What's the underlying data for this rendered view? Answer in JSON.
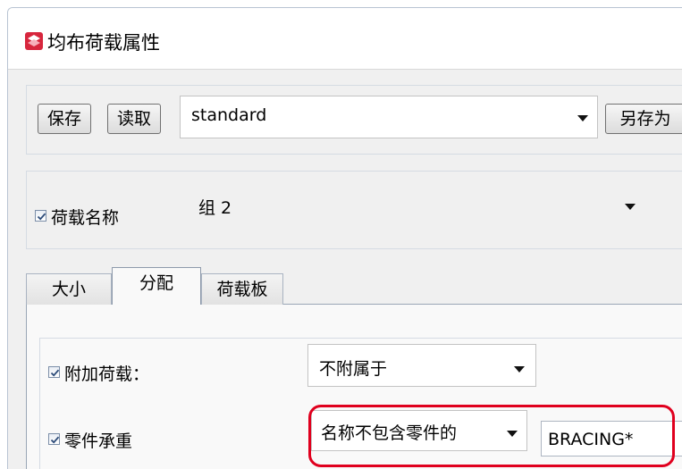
{
  "window": {
    "title": "均布荷载属性",
    "icon": "tekla-app-icon"
  },
  "toolbar": {
    "save_label": "保存",
    "load_label": "读取",
    "preset_value": "standard",
    "save_as_label": "另存为"
  },
  "load_name": {
    "checkbox_checked": true,
    "label": "荷载名称",
    "value": "组 2"
  },
  "tabs": [
    {
      "label": "大小",
      "active": false
    },
    {
      "label": "分配",
      "active": true
    },
    {
      "label": "荷载板",
      "active": false
    }
  ],
  "distribution": {
    "attach_load": {
      "checked": true,
      "label": "附加荷载：",
      "value": "不附属于"
    },
    "part_bearing": {
      "checked": true,
      "label": "零件承重",
      "filter_value": "名称不包含零件的",
      "filter_text": "BRACING*"
    }
  },
  "colors": {
    "highlight": "#e0001e",
    "window_bg": "#f0f0f0"
  }
}
